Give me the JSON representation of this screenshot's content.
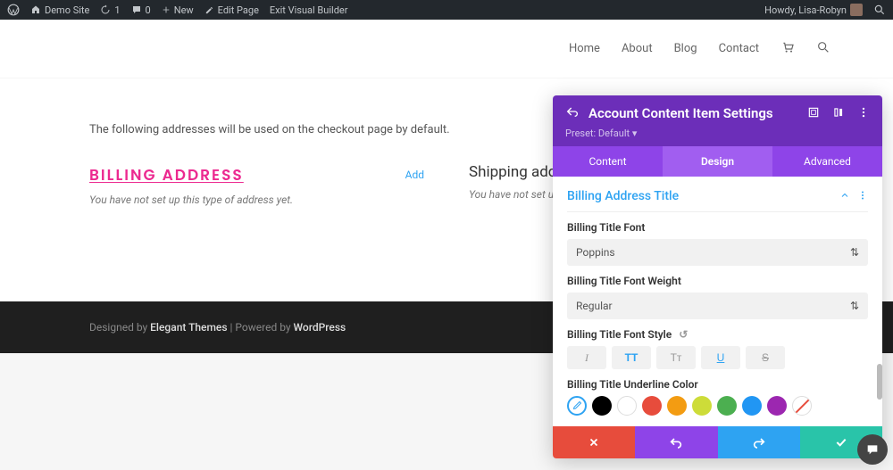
{
  "admin": {
    "site": "Demo Site",
    "updates": "1",
    "comments": "0",
    "new": "New",
    "edit": "Edit Page",
    "exit": "Exit Visual Builder",
    "howdy": "Howdy, Lisa-Robyn"
  },
  "nav": {
    "home": "Home",
    "about": "About",
    "blog": "Blog",
    "contact": "Contact"
  },
  "page": {
    "intro": "The following addresses will be used on the checkout page by default.",
    "billing_title": "BILLING ADDRESS",
    "shipping_title": "Shipping add",
    "add": "Add",
    "no_address": "You have not set up this type of address yet.",
    "no_address_trunc": "You have not set up t"
  },
  "footer": {
    "designed": "Designed by ",
    "theme": "Elegant Themes",
    "sep": " | Powered by ",
    "platform": "WordPress"
  },
  "panel": {
    "title": "Account Content Item Settings",
    "preset": "Preset: Default",
    "tabs": {
      "content": "Content",
      "design": "Design",
      "advanced": "Advanced"
    },
    "section": "Billing Address Title",
    "fields": {
      "font_label": "Billing Title Font",
      "font_value": "Poppins",
      "weight_label": "Billing Title Font Weight",
      "weight_value": "Regular",
      "style_label": "Billing Title Font Style",
      "color_label": "Billing Title Underline Color"
    },
    "style_btns": {
      "italic": "I",
      "upper": "TT",
      "small": "Tᴛ",
      "underline": "U",
      "strike": "S"
    },
    "colors": [
      "#000000",
      "#ffffff",
      "#e74c3c",
      "#f39c12",
      "#cddc39",
      "#4caf50",
      "#2196f3",
      "#9c27b0"
    ]
  }
}
